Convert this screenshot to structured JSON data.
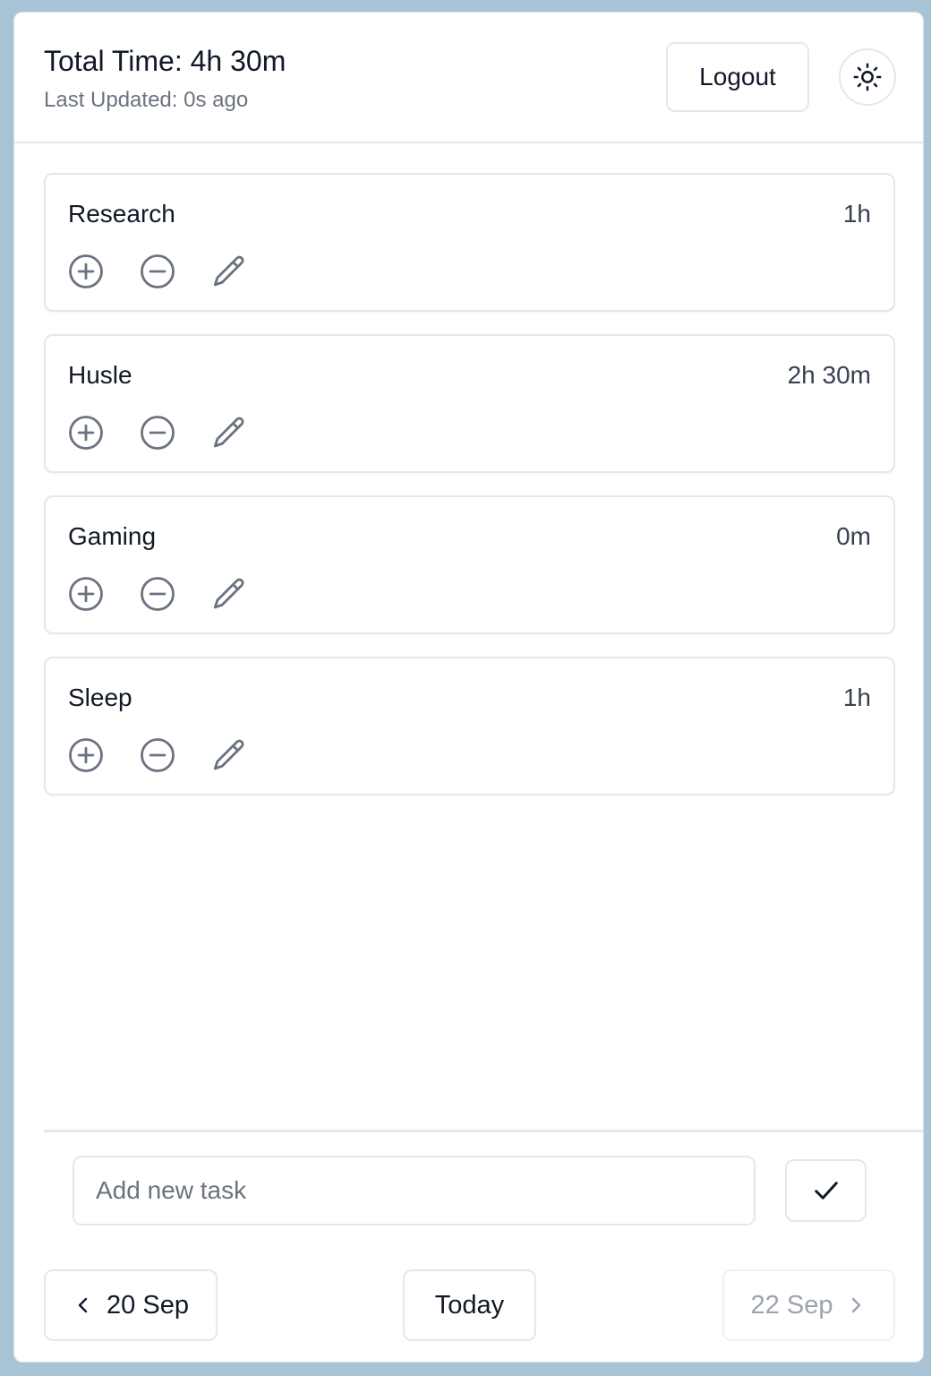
{
  "header": {
    "total_time": "Total Time: 4h 30m",
    "last_updated": "Last Updated: 0s ago",
    "logout_label": "Logout",
    "theme_icon": "sun-icon"
  },
  "tasks": [
    {
      "name": "Research",
      "time": "1h"
    },
    {
      "name": "Husle",
      "time": "2h 30m"
    },
    {
      "name": "Gaming",
      "time": "0m"
    },
    {
      "name": "Sleep",
      "time": "1h"
    }
  ],
  "task_actions": [
    "plus-circle-icon",
    "minus-circle-icon",
    "pencil-icon"
  ],
  "new_task": {
    "placeholder": "Add new task",
    "value": "",
    "submit_icon": "check-icon"
  },
  "navigation": {
    "prev_label": "20 Sep",
    "today_label": "Today",
    "next_label": "22 Sep",
    "next_disabled": true
  },
  "colors": {
    "background": "#a9c3d6",
    "surface": "#ffffff",
    "border": "#e5e7eb",
    "text": "#111827",
    "muted": "#6b7280",
    "icon": "#6b7280",
    "disabled": "#9ca3af"
  }
}
